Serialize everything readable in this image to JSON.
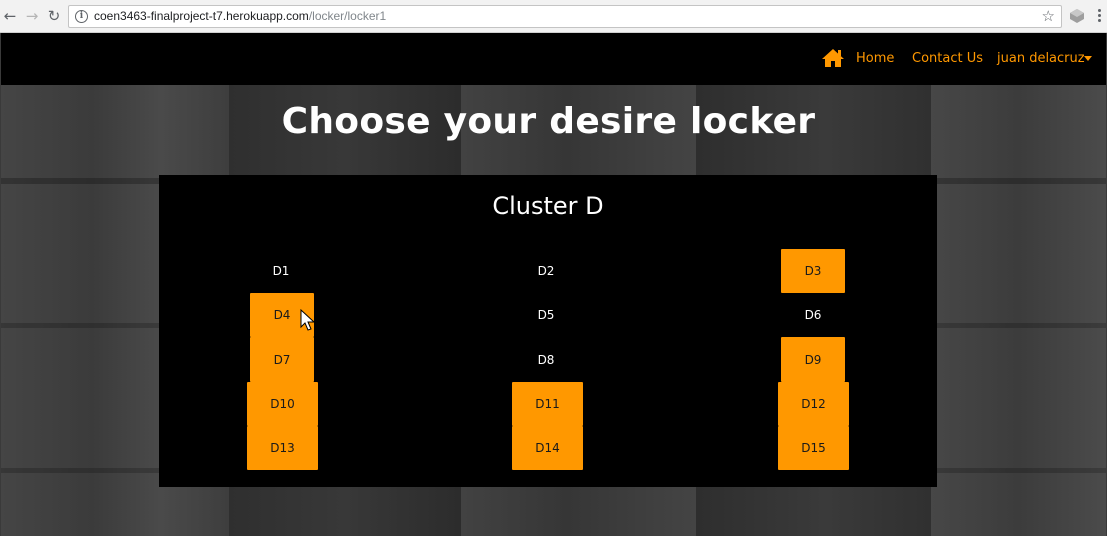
{
  "browser": {
    "url_host": "coen3463-finalproject-t7.herokuapp.com",
    "url_path": "/locker/locker1",
    "icons": [
      "back-arrow-icon",
      "forward-arrow-icon",
      "reload-icon",
      "info-icon",
      "star-icon",
      "extension-icon",
      "kebab-menu-icon"
    ]
  },
  "navbar": {
    "home_label": "Home",
    "contact_label": "Contact Us",
    "user_label": "juan delacruz",
    "accent_color": "#ff9800"
  },
  "page": {
    "heading": "Choose your desire locker",
    "cluster_title": "Cluster D"
  },
  "lockers": [
    {
      "id": "D1",
      "label": "D1",
      "available": false
    },
    {
      "id": "D2",
      "label": "D2",
      "available": false
    },
    {
      "id": "D3",
      "label": "D3",
      "available": true
    },
    {
      "id": "D4",
      "label": "D4",
      "available": true
    },
    {
      "id": "D5",
      "label": "D5",
      "available": false
    },
    {
      "id": "D6",
      "label": "D6",
      "available": false
    },
    {
      "id": "D7",
      "label": "D7",
      "available": true
    },
    {
      "id": "D8",
      "label": "D8",
      "available": false
    },
    {
      "id": "D9",
      "label": "D9",
      "available": true
    },
    {
      "id": "D10",
      "label": "D10",
      "available": true
    },
    {
      "id": "D11",
      "label": "D11",
      "available": true
    },
    {
      "id": "D12",
      "label": "D12",
      "available": true
    },
    {
      "id": "D13",
      "label": "D13",
      "available": true
    },
    {
      "id": "D14",
      "label": "D14",
      "available": true
    },
    {
      "id": "D15",
      "label": "D15",
      "available": true
    }
  ]
}
